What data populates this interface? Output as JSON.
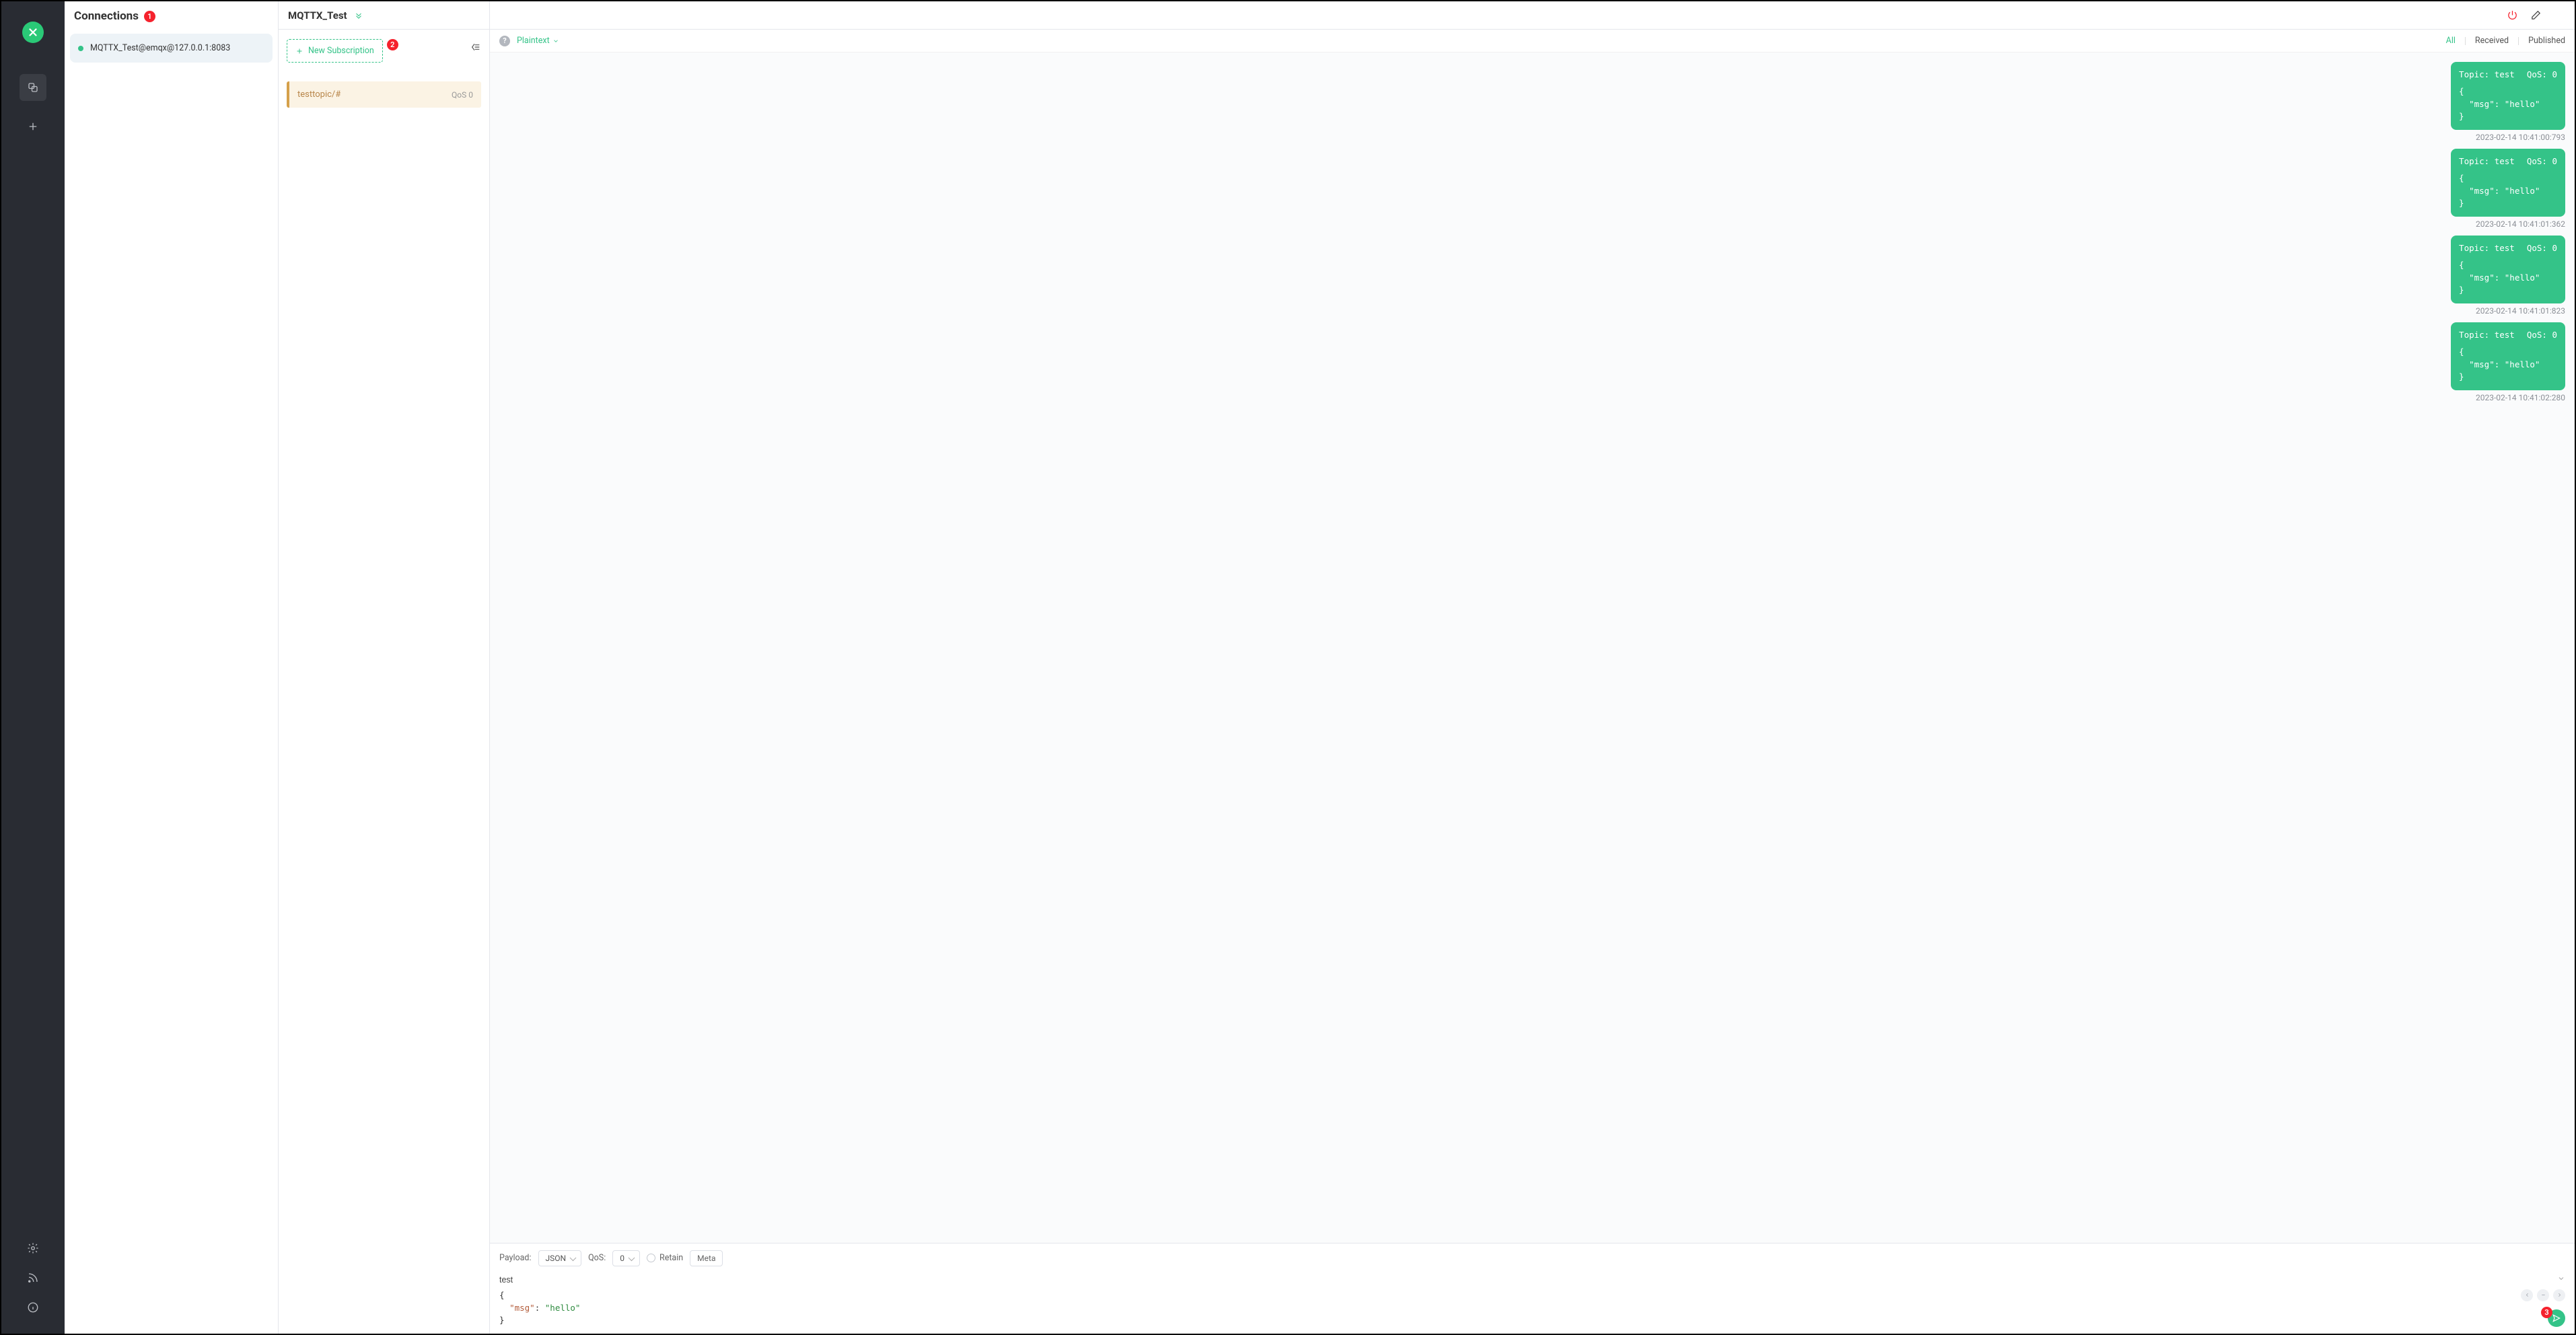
{
  "rail": {
    "logo_alt": "MQTTX"
  },
  "connections": {
    "title": "Connections",
    "badge": "1",
    "items": [
      {
        "label": "MQTTX_Test@emqx@127.0.0.1:8083"
      }
    ]
  },
  "header": {
    "title": "MQTTX_Test"
  },
  "subs": {
    "new_label": "New Subscription",
    "new_badge": "2",
    "items": [
      {
        "topic": "testtopic/#",
        "qos": "QoS 0"
      }
    ]
  },
  "chat_toolbar": {
    "format": "Plaintext",
    "filters": {
      "all": "All",
      "received": "Received",
      "published": "Published"
    }
  },
  "messages": [
    {
      "topic": "Topic: test",
      "qos": "QoS: 0",
      "body": "{\n  \"msg\": \"hello\"\n}",
      "time": "2023-02-14 10:41:00:793"
    },
    {
      "topic": "Topic: test",
      "qos": "QoS: 0",
      "body": "{\n  \"msg\": \"hello\"\n}",
      "time": "2023-02-14 10:41:01:362"
    },
    {
      "topic": "Topic: test",
      "qos": "QoS: 0",
      "body": "{\n  \"msg\": \"hello\"\n}",
      "time": "2023-02-14 10:41:01:823"
    },
    {
      "topic": "Topic: test",
      "qos": "QoS: 0",
      "body": "{\n  \"msg\": \"hello\"\n}",
      "time": "2023-02-14 10:41:02:280"
    }
  ],
  "publish": {
    "payload_label": "Payload:",
    "payload_format": "JSON",
    "qos_label": "QoS:",
    "qos_value": "0",
    "retain_label": "Retain",
    "meta_label": "Meta",
    "topic": "test",
    "body_key": "\"msg\"",
    "body_val": "\"hello\"",
    "send_badge": "3"
  }
}
